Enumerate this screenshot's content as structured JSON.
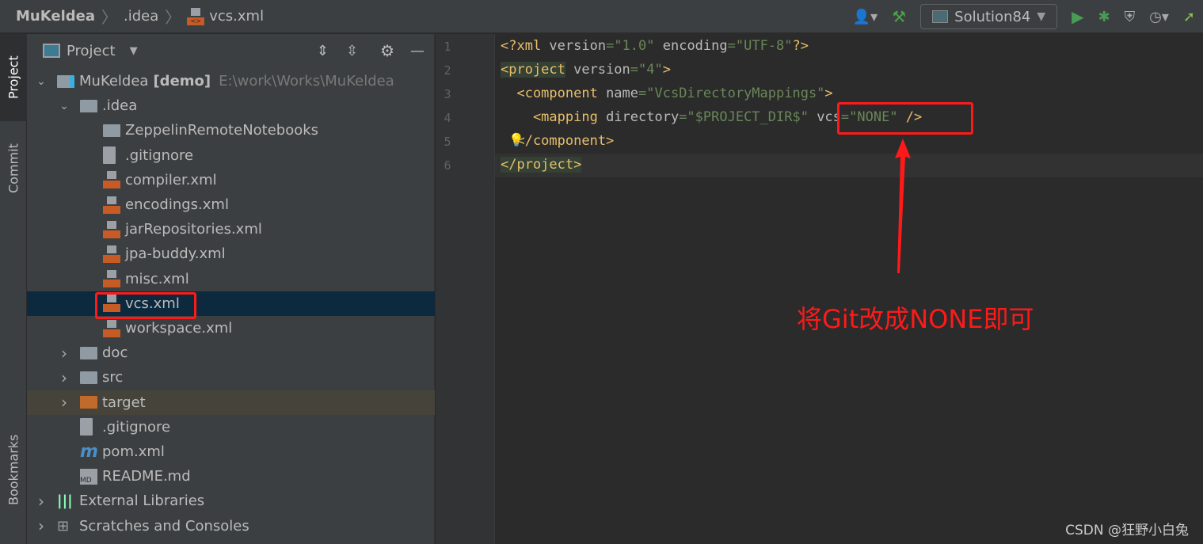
{
  "breadcrumb": [
    "MuKeldea",
    ".idea",
    "vcs.xml"
  ],
  "toolbar": {
    "run_config": "Solution84",
    "icons": [
      "user-icon",
      "build-hammer-icon",
      "run-icon",
      "debug-icon",
      "coverage-icon",
      "profile-icon",
      "deploy-icon"
    ]
  },
  "side_tabs": {
    "project": "Project",
    "commit": "Commit",
    "bookmarks": "Bookmarks"
  },
  "panel": {
    "title": "Project"
  },
  "tree": [
    {
      "label": "MuKeldea",
      "bold": "[demo]",
      "path": "E:\\work\\Works\\MuKeldea",
      "depth": 0,
      "type": "module",
      "open": true
    },
    {
      "label": ".idea",
      "depth": 1,
      "type": "folder",
      "open": true
    },
    {
      "label": "ZeppelinRemoteNotebooks",
      "depth": 2,
      "type": "folder"
    },
    {
      "label": ".gitignore",
      "depth": 2,
      "type": "git"
    },
    {
      "label": "compiler.xml",
      "depth": 2,
      "type": "xml"
    },
    {
      "label": "encodings.xml",
      "depth": 2,
      "type": "xml"
    },
    {
      "label": "jarRepositories.xml",
      "depth": 2,
      "type": "xml"
    },
    {
      "label": "jpa-buddy.xml",
      "depth": 2,
      "type": "xml"
    },
    {
      "label": "misc.xml",
      "depth": 2,
      "type": "xml"
    },
    {
      "label": "vcs.xml",
      "depth": 2,
      "type": "xml",
      "selected": true
    },
    {
      "label": "workspace.xml",
      "depth": 2,
      "type": "xml"
    },
    {
      "label": "doc",
      "depth": 1,
      "type": "folder",
      "closed": true
    },
    {
      "label": "src",
      "depth": 1,
      "type": "folder",
      "closed": true
    },
    {
      "label": "target",
      "depth": 1,
      "type": "folder-orange",
      "closed": true
    },
    {
      "label": ".gitignore",
      "depth": 1,
      "type": "git"
    },
    {
      "label": "pom.xml",
      "depth": 1,
      "type": "maven"
    },
    {
      "label": "README.md",
      "depth": 1,
      "type": "md"
    },
    {
      "label": "External Libraries",
      "depth": 0,
      "type": "lib",
      "closed": true
    },
    {
      "label": "Scratches and Consoles",
      "depth": 0,
      "type": "scratch",
      "closed": true
    }
  ],
  "editor": {
    "line_numbers": [
      "1",
      "2",
      "3",
      "4",
      "5",
      "6"
    ],
    "lines": [
      [
        [
          "t",
          "<?xml "
        ],
        [
          "a",
          "version"
        ],
        [
          "v",
          "=\"1.0\" "
        ],
        [
          "a",
          "encoding"
        ],
        [
          "v",
          "=\"UTF-8\""
        ],
        [
          "t",
          "?>"
        ]
      ],
      [
        [
          "th",
          "<project"
        ],
        [
          "a",
          " version"
        ],
        [
          "v",
          "=\"4\""
        ],
        [
          "t",
          ">"
        ]
      ],
      [
        [
          "t",
          "  <component "
        ],
        [
          "a",
          "name"
        ],
        [
          "v",
          "=\"VcsDirectoryMappings\""
        ],
        [
          "t",
          ">"
        ]
      ],
      [
        [
          "t",
          "    <mapping "
        ],
        [
          "a",
          "directory"
        ],
        [
          "v",
          "=\"$PROJECT_DIR$\" "
        ],
        [
          "a",
          "vcs"
        ],
        [
          "v",
          "=\"NONE\" "
        ],
        [
          "t",
          "/>"
        ]
      ],
      [
        [
          "t",
          "  </component>"
        ]
      ],
      [
        [
          "th",
          "</project>"
        ]
      ]
    ]
  },
  "annotation": "将Git改成NONE即可",
  "watermark": "CSDN @狂野小白兔",
  "colors": {
    "annotation": "#ff1a1a",
    "selection": "#0d293e"
  }
}
